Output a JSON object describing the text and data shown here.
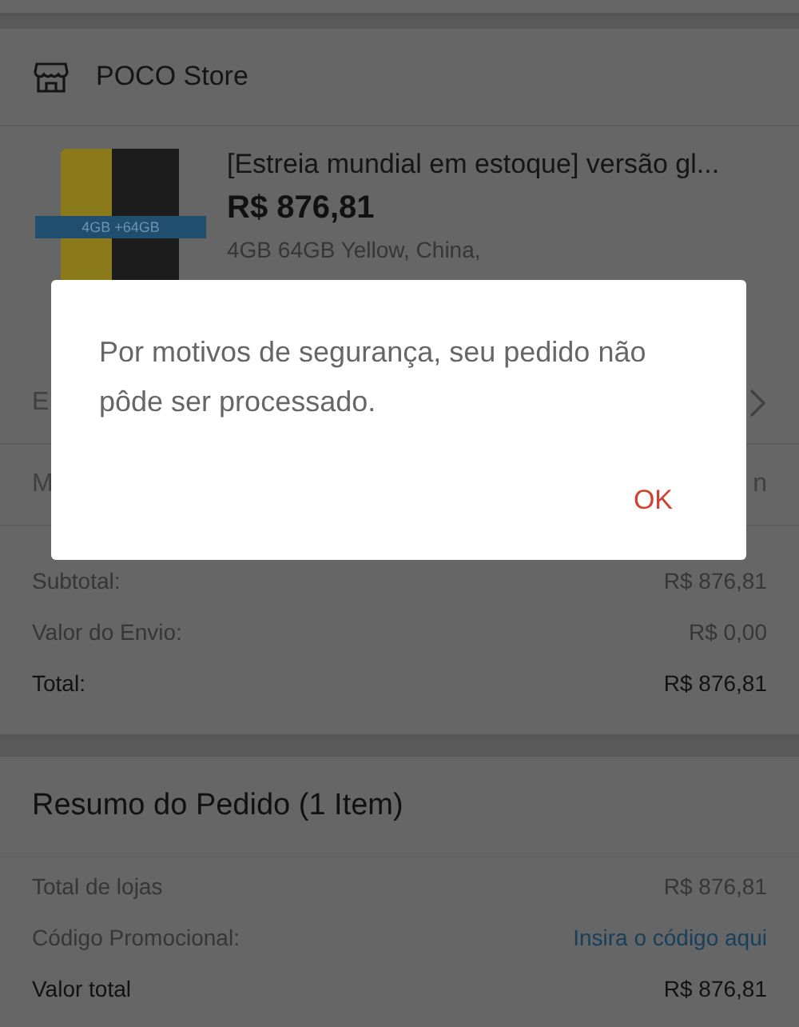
{
  "store": {
    "name": "POCO Store"
  },
  "product": {
    "title": "[Estreia mundial em estoque] versão gl...",
    "price": "R$ 876,81",
    "variant": "4GB 64GB Yellow, China,",
    "image_badge": "4GB +64GB"
  },
  "hidden_rows": [
    {
      "label": "E",
      "value": "",
      "chevron": true
    },
    {
      "label": "M",
      "value": "n",
      "chevron": false
    }
  ],
  "totals": [
    {
      "label": "Subtotal:",
      "value": "R$ 876,81",
      "emphasis": false
    },
    {
      "label": "Valor do Envio:",
      "value": "R$ 0,00",
      "emphasis": false
    },
    {
      "label": "Total:",
      "value": "R$ 876,81",
      "emphasis": true
    }
  ],
  "summary": {
    "title": "Resumo do Pedido (1 Item)",
    "rows": [
      {
        "label": "Total de lojas",
        "value": "R$ 876,81",
        "kind": "amount"
      },
      {
        "label": "Código Promocional:",
        "value": "Insira o código aqui",
        "kind": "link"
      },
      {
        "label": "Valor total",
        "value": "R$ 876,81",
        "kind": "total"
      }
    ]
  },
  "dialog": {
    "message": "Por motivos de segurança, seu pedido não pôde ser processado.",
    "button": "OK"
  }
}
